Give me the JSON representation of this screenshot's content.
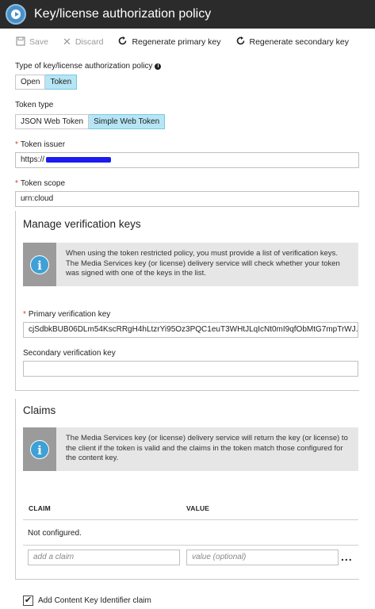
{
  "window": {
    "title": "Key/license authorization policy"
  },
  "toolbar": {
    "save": "Save",
    "discard": "Discard",
    "regen_primary": "Regenerate primary key",
    "regen_secondary": "Regenerate secondary key"
  },
  "policy_type": {
    "label": "Type of key/license authorization policy",
    "options": [
      "Open",
      "Token"
    ],
    "selected": "Token"
  },
  "token_type": {
    "label": "Token type",
    "options": [
      "JSON Web Token",
      "Simple Web Token"
    ],
    "selected": "Simple Web Token"
  },
  "token_issuer": {
    "label": "Token issuer",
    "value": "https://"
  },
  "token_scope": {
    "label": "Token scope",
    "value": "urn:cloud"
  },
  "verification": {
    "title": "Manage verification keys",
    "info": "When using the token restricted policy, you must provide a list of verification keys. The Media Services key (or license) delivery service will check whether your token was signed with one of the keys in the list.",
    "primary_label": "Primary verification key",
    "primary_value": "cjSdbkBUB06DLm54KscRRgH4hLtzrYi95Oz3PQC1euT3WHtJLqIcNt0mI9qfObMtG7mpTrWJ...",
    "secondary_label": "Secondary verification key",
    "secondary_value": ""
  },
  "claims": {
    "title": "Claims",
    "info": "The Media Services key (or license) delivery service will return the key (or license) to the client if the token is valid and the claims in the token match those configured for the content key.",
    "col_claim": "CLAIM",
    "col_value": "VALUE",
    "empty_text": "Not configured.",
    "claim_placeholder": "add a claim",
    "value_placeholder": "value (optional)",
    "more": "..."
  },
  "content_key_claim": {
    "label": "Add Content Key Identifier claim",
    "checked": true
  }
}
